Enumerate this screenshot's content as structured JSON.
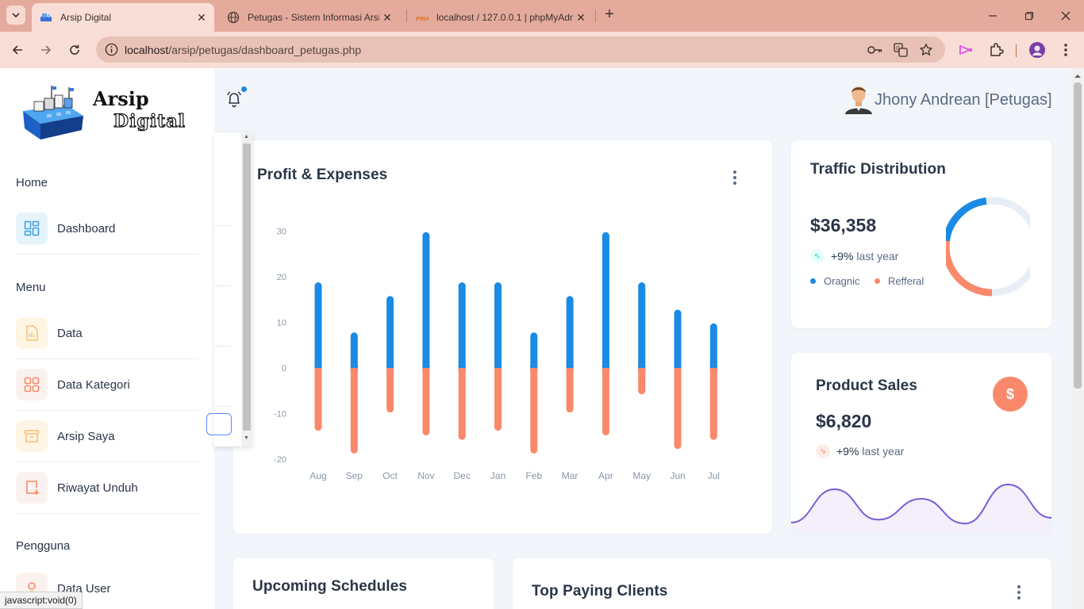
{
  "browser": {
    "tabs": [
      {
        "title": "Arsip Digital",
        "active": true
      },
      {
        "title": "Petugas - Sistem Informasi Arsip",
        "active": false
      },
      {
        "title": "localhost / 127.0.0.1 | phpMyAdmin",
        "active": false
      }
    ],
    "url_host": "localhost",
    "url_path": "/arsip/petugas/dashboard_petugas.php",
    "status_text": "javascript:void(0)",
    "theme_color": "#e4ab9d"
  },
  "sidebar": {
    "logo_line1": "Arsip",
    "logo_line2": "Digital",
    "sections": [
      {
        "caption": "Home",
        "items": [
          {
            "label": "Dashboard",
            "icon": "layout-dashboard-icon"
          }
        ]
      },
      {
        "caption": "Menu",
        "items": [
          {
            "label": "Data",
            "icon": "file-chart-icon"
          },
          {
            "label": "Data Kategori",
            "icon": "layout-grid-icon"
          },
          {
            "label": "Arsip Saya",
            "icon": "archive-icon"
          },
          {
            "label": "Riwayat Unduh",
            "icon": "download-receipt-icon"
          }
        ]
      },
      {
        "caption": "Pengguna",
        "items": [
          {
            "label": "Data User",
            "icon": "user-icon"
          }
        ]
      }
    ]
  },
  "header": {
    "user_name": "Jhony Andrean [Petugas]",
    "notification_indicator": true
  },
  "profit_card": {
    "title": "Profit & Expenses"
  },
  "traffic_card": {
    "title": "Traffic Distribution",
    "value": "$36,358",
    "change": "+9%",
    "change_text": "last year",
    "legend": [
      "Oragnic",
      "Refferal"
    ]
  },
  "sales_card": {
    "title": "Product Sales",
    "value": "$6,820",
    "change": "+9%",
    "change_text": "last year",
    "icon": "dollar-icon"
  },
  "schedules_card": {
    "title": "Upcoming Schedules"
  },
  "clients_card": {
    "title": "Top Paying Clients"
  },
  "colors": {
    "primary": "#1a8ae5",
    "secondary": "#fa896b",
    "sales_line": "#7b5bd6"
  },
  "chart_data": [
    {
      "type": "bar",
      "categories": [
        "Aug",
        "Sep",
        "Oct",
        "Nov",
        "Dec",
        "Jan",
        "Feb",
        "Mar",
        "Apr",
        "May",
        "Jun",
        "Jul"
      ],
      "series": [
        {
          "values": [
            18,
            7,
            15,
            29,
            18,
            18,
            7,
            15,
            29,
            18,
            12,
            9
          ]
        },
        {
          "values": [
            -13,
            -18,
            -9,
            -14,
            -15,
            -13,
            -18,
            -9,
            -14,
            -5,
            -17,
            -15
          ]
        }
      ],
      "ylim": [
        -20,
        30
      ],
      "yticks": [
        -20,
        -10,
        0,
        10,
        20,
        30
      ],
      "stacked": true,
      "grid": false
    },
    {
      "type": "pie",
      "donut": true,
      "series": [
        {
          "name": "Oragnic",
          "value": 23
        },
        {
          "name": "Refferal",
          "value": 27
        },
        {
          "name": "",
          "value": 50
        }
      ]
    },
    {
      "type": "area",
      "values": [
        5,
        40,
        8,
        30,
        4,
        45,
        10
      ],
      "ylim": [
        0,
        50
      ],
      "axes": false
    }
  ]
}
